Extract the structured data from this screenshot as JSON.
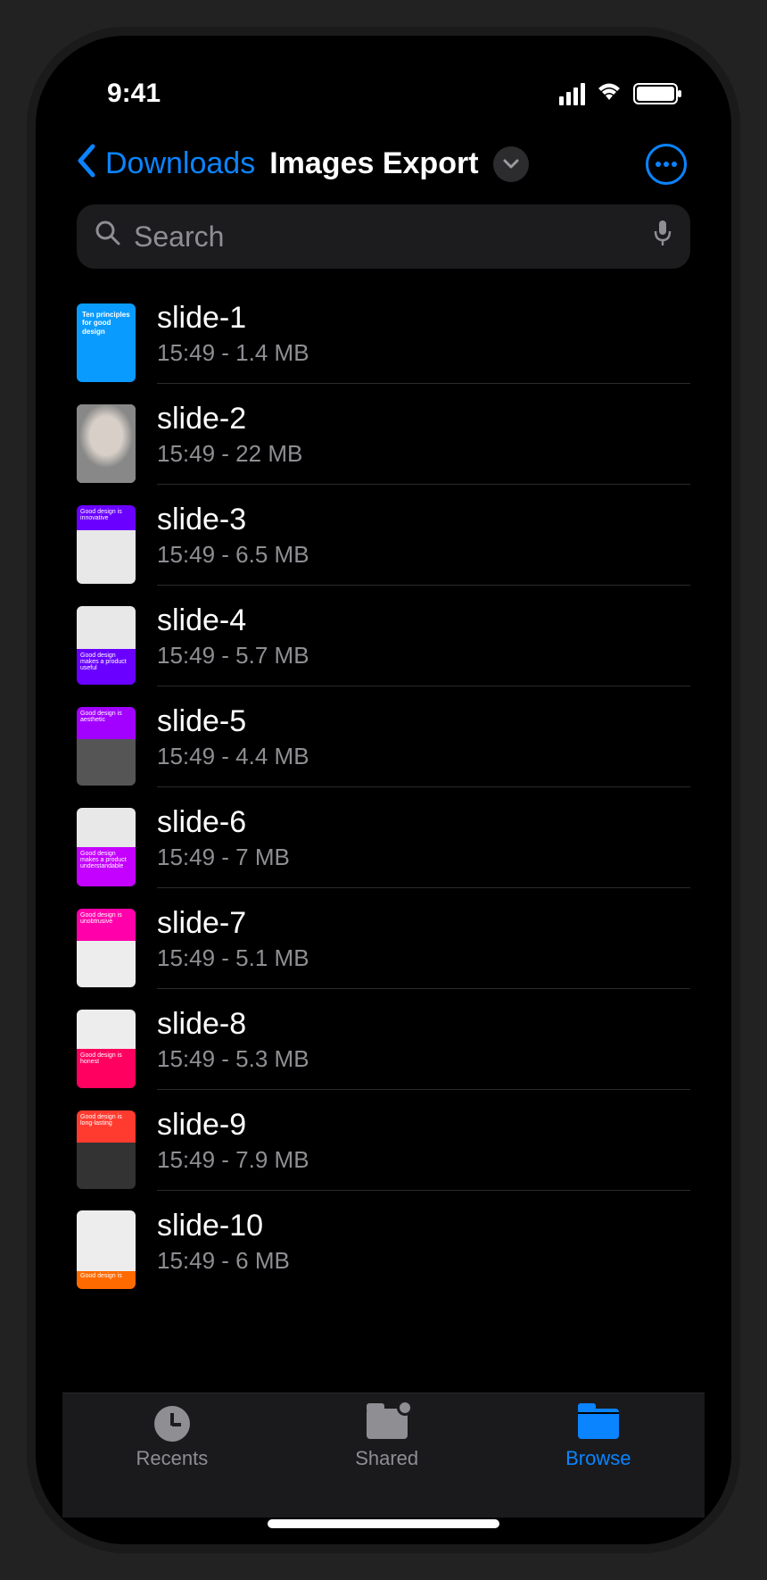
{
  "status": {
    "time": "9:41"
  },
  "nav": {
    "back_label": "Downloads",
    "title": "Images Export"
  },
  "search": {
    "placeholder": "Search"
  },
  "files": [
    {
      "name": "slide-1",
      "meta": "15:49 - 1.4 MB",
      "thumb_class": "t1",
      "thumb_text": "Ten principles for good design"
    },
    {
      "name": "slide-2",
      "meta": "15:49 - 22 MB",
      "thumb_class": "t2",
      "thumb_text": ""
    },
    {
      "name": "slide-3",
      "meta": "15:49 - 6.5 MB",
      "thumb_class": "t3",
      "thumb_text": "Good design is innovative"
    },
    {
      "name": "slide-4",
      "meta": "15:49 - 5.7 MB",
      "thumb_class": "t4",
      "thumb_text": "Good design makes a product useful"
    },
    {
      "name": "slide-5",
      "meta": "15:49 - 4.4 MB",
      "thumb_class": "t5",
      "thumb_text": "Good design is aesthetic"
    },
    {
      "name": "slide-6",
      "meta": "15:49 - 7 MB",
      "thumb_class": "t6",
      "thumb_text": "Good design makes a product understandable"
    },
    {
      "name": "slide-7",
      "meta": "15:49 - 5.1 MB",
      "thumb_class": "t7",
      "thumb_text": "Good design is unobtrusive"
    },
    {
      "name": "slide-8",
      "meta": "15:49 - 5.3 MB",
      "thumb_class": "t8",
      "thumb_text": "Good design is honest"
    },
    {
      "name": "slide-9",
      "meta": "15:49 - 7.9 MB",
      "thumb_class": "t9",
      "thumb_text": "Good design is long-lasting"
    },
    {
      "name": "slide-10",
      "meta": "15:49 - 6 MB",
      "thumb_class": "t10",
      "thumb_text": "Good design is"
    }
  ],
  "tabs": {
    "recents": "Recents",
    "shared": "Shared",
    "browse": "Browse"
  }
}
